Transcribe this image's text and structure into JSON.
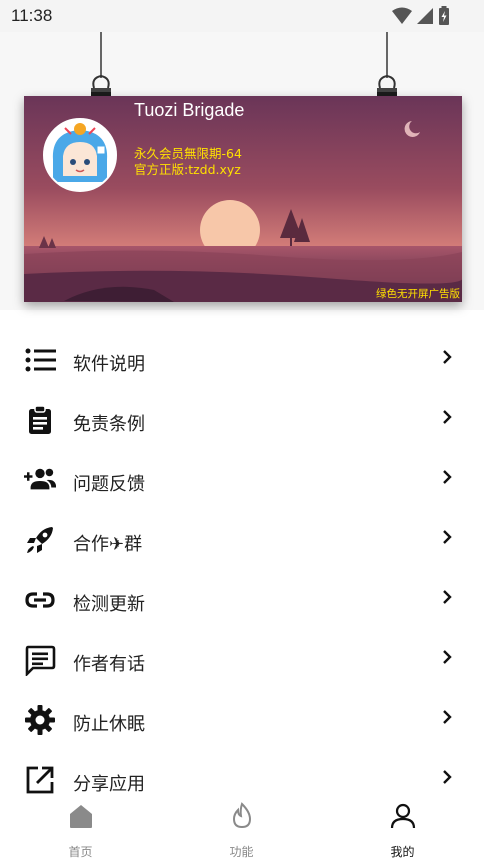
{
  "status_bar": {
    "time": "11:38"
  },
  "banner": {
    "username": "Tuozi Brigade",
    "vip_text": "永久会员無限期-64",
    "site_text": "官方正版:tzdd.xyz",
    "ad_free_text": "绿色无开屏广告版"
  },
  "menu": {
    "items": [
      {
        "label": "软件说明",
        "icon": "list-icon"
      },
      {
        "label": "免责条例",
        "icon": "clipboard-icon"
      },
      {
        "label": "问题反馈",
        "icon": "group-add-icon"
      },
      {
        "label": "合作✈群",
        "icon": "rocket-icon"
      },
      {
        "label": "检测更新",
        "icon": "link-icon"
      },
      {
        "label": "作者有话",
        "icon": "message-icon"
      },
      {
        "label": "防止休眠",
        "icon": "gear-icon"
      },
      {
        "label": "分享应用",
        "icon": "share-icon"
      }
    ]
  },
  "bottom_nav": {
    "tabs": [
      {
        "label": "首页",
        "icon": "home-icon",
        "active": false
      },
      {
        "label": "功能",
        "icon": "fire-icon",
        "active": false
      },
      {
        "label": "我的",
        "icon": "person-icon",
        "active": true
      }
    ]
  }
}
